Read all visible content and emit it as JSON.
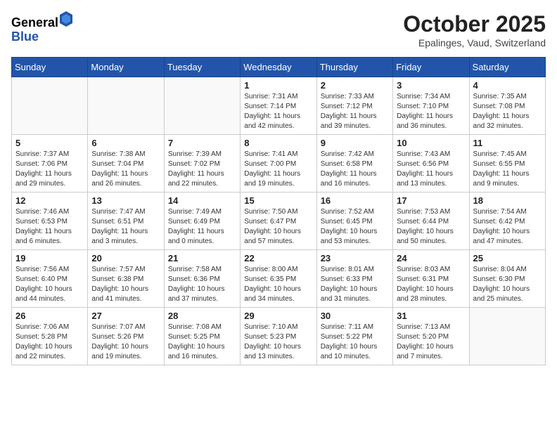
{
  "header": {
    "logo_general": "General",
    "logo_blue": "Blue",
    "month": "October 2025",
    "location": "Epalinges, Vaud, Switzerland"
  },
  "weekdays": [
    "Sunday",
    "Monday",
    "Tuesday",
    "Wednesday",
    "Thursday",
    "Friday",
    "Saturday"
  ],
  "weeks": [
    [
      {
        "day": "",
        "info": ""
      },
      {
        "day": "",
        "info": ""
      },
      {
        "day": "",
        "info": ""
      },
      {
        "day": "1",
        "info": "Sunrise: 7:31 AM\nSunset: 7:14 PM\nDaylight: 11 hours\nand 42 minutes."
      },
      {
        "day": "2",
        "info": "Sunrise: 7:33 AM\nSunset: 7:12 PM\nDaylight: 11 hours\nand 39 minutes."
      },
      {
        "day": "3",
        "info": "Sunrise: 7:34 AM\nSunset: 7:10 PM\nDaylight: 11 hours\nand 36 minutes."
      },
      {
        "day": "4",
        "info": "Sunrise: 7:35 AM\nSunset: 7:08 PM\nDaylight: 11 hours\nand 32 minutes."
      }
    ],
    [
      {
        "day": "5",
        "info": "Sunrise: 7:37 AM\nSunset: 7:06 PM\nDaylight: 11 hours\nand 29 minutes."
      },
      {
        "day": "6",
        "info": "Sunrise: 7:38 AM\nSunset: 7:04 PM\nDaylight: 11 hours\nand 26 minutes."
      },
      {
        "day": "7",
        "info": "Sunrise: 7:39 AM\nSunset: 7:02 PM\nDaylight: 11 hours\nand 22 minutes."
      },
      {
        "day": "8",
        "info": "Sunrise: 7:41 AM\nSunset: 7:00 PM\nDaylight: 11 hours\nand 19 minutes."
      },
      {
        "day": "9",
        "info": "Sunrise: 7:42 AM\nSunset: 6:58 PM\nDaylight: 11 hours\nand 16 minutes."
      },
      {
        "day": "10",
        "info": "Sunrise: 7:43 AM\nSunset: 6:56 PM\nDaylight: 11 hours\nand 13 minutes."
      },
      {
        "day": "11",
        "info": "Sunrise: 7:45 AM\nSunset: 6:55 PM\nDaylight: 11 hours\nand 9 minutes."
      }
    ],
    [
      {
        "day": "12",
        "info": "Sunrise: 7:46 AM\nSunset: 6:53 PM\nDaylight: 11 hours\nand 6 minutes."
      },
      {
        "day": "13",
        "info": "Sunrise: 7:47 AM\nSunset: 6:51 PM\nDaylight: 11 hours\nand 3 minutes."
      },
      {
        "day": "14",
        "info": "Sunrise: 7:49 AM\nSunset: 6:49 PM\nDaylight: 11 hours\nand 0 minutes."
      },
      {
        "day": "15",
        "info": "Sunrise: 7:50 AM\nSunset: 6:47 PM\nDaylight: 10 hours\nand 57 minutes."
      },
      {
        "day": "16",
        "info": "Sunrise: 7:52 AM\nSunset: 6:45 PM\nDaylight: 10 hours\nand 53 minutes."
      },
      {
        "day": "17",
        "info": "Sunrise: 7:53 AM\nSunset: 6:44 PM\nDaylight: 10 hours\nand 50 minutes."
      },
      {
        "day": "18",
        "info": "Sunrise: 7:54 AM\nSunset: 6:42 PM\nDaylight: 10 hours\nand 47 minutes."
      }
    ],
    [
      {
        "day": "19",
        "info": "Sunrise: 7:56 AM\nSunset: 6:40 PM\nDaylight: 10 hours\nand 44 minutes."
      },
      {
        "day": "20",
        "info": "Sunrise: 7:57 AM\nSunset: 6:38 PM\nDaylight: 10 hours\nand 41 minutes."
      },
      {
        "day": "21",
        "info": "Sunrise: 7:58 AM\nSunset: 6:36 PM\nDaylight: 10 hours\nand 37 minutes."
      },
      {
        "day": "22",
        "info": "Sunrise: 8:00 AM\nSunset: 6:35 PM\nDaylight: 10 hours\nand 34 minutes."
      },
      {
        "day": "23",
        "info": "Sunrise: 8:01 AM\nSunset: 6:33 PM\nDaylight: 10 hours\nand 31 minutes."
      },
      {
        "day": "24",
        "info": "Sunrise: 8:03 AM\nSunset: 6:31 PM\nDaylight: 10 hours\nand 28 minutes."
      },
      {
        "day": "25",
        "info": "Sunrise: 8:04 AM\nSunset: 6:30 PM\nDaylight: 10 hours\nand 25 minutes."
      }
    ],
    [
      {
        "day": "26",
        "info": "Sunrise: 7:06 AM\nSunset: 5:28 PM\nDaylight: 10 hours\nand 22 minutes."
      },
      {
        "day": "27",
        "info": "Sunrise: 7:07 AM\nSunset: 5:26 PM\nDaylight: 10 hours\nand 19 minutes."
      },
      {
        "day": "28",
        "info": "Sunrise: 7:08 AM\nSunset: 5:25 PM\nDaylight: 10 hours\nand 16 minutes."
      },
      {
        "day": "29",
        "info": "Sunrise: 7:10 AM\nSunset: 5:23 PM\nDaylight: 10 hours\nand 13 minutes."
      },
      {
        "day": "30",
        "info": "Sunrise: 7:11 AM\nSunset: 5:22 PM\nDaylight: 10 hours\nand 10 minutes."
      },
      {
        "day": "31",
        "info": "Sunrise: 7:13 AM\nSunset: 5:20 PM\nDaylight: 10 hours\nand 7 minutes."
      },
      {
        "day": "",
        "info": ""
      }
    ]
  ]
}
